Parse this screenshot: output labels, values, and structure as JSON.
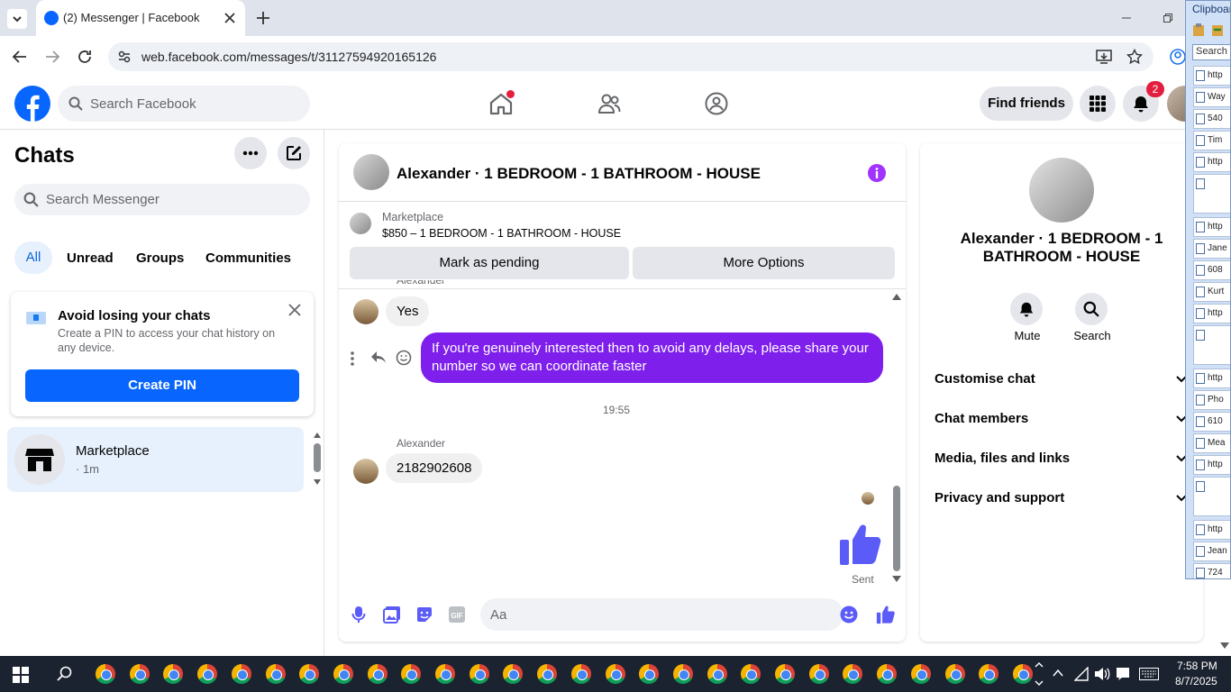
{
  "browser": {
    "tab_title": "(2) Messenger | Facebook",
    "url": "web.facebook.com/messages/t/31127594920165126"
  },
  "header": {
    "search_placeholder": "Search Facebook",
    "find_friends": "Find friends",
    "notifications_count": "2"
  },
  "sidebar": {
    "title": "Chats",
    "search_placeholder": "Search Messenger",
    "filters": [
      "All",
      "Unread",
      "Groups",
      "Communities"
    ],
    "pin_card": {
      "title": "Avoid losing your chats",
      "description": "Create a PIN to access your chat history on any device.",
      "button": "Create PIN"
    },
    "chat_item": {
      "name": "Marketplace",
      "time": "· 1m"
    }
  },
  "conversation": {
    "title": "Alexander · 1 BEDROOM - 1 BATHROOM - HOUSE",
    "marketplace_label": "Marketplace",
    "listing": "$850 – 1 BEDROOM - 1 BATHROOM - HOUSE",
    "mark_pending": "Mark as pending",
    "more_options": "More Options",
    "messages": {
      "sender_cut": "Alexander",
      "reply_yes": "Yes",
      "outgoing": "If you're genuinely interested then to avoid any delays, please share your number so we can coordinate faster",
      "timestamp": "19:55",
      "sender": "Alexander",
      "phone": "2182902608",
      "sent_status": "Sent"
    },
    "composer_placeholder": "Aa"
  },
  "details": {
    "name": "Alexander · 1 BEDROOM - 1 BATHROOM - HOUSE",
    "mute": "Mute",
    "search": "Search",
    "sections": [
      "Customise chat",
      "Chat members",
      "Media, files and links",
      "Privacy and support"
    ]
  },
  "clipboard": {
    "title": "Clipboard",
    "search": "Search (",
    "items": [
      "http",
      "Way",
      "540",
      "Tim",
      "http",
      "",
      "http",
      "Jane",
      "608",
      "Kurt",
      "http",
      "",
      "http",
      "Pho",
      "610",
      "Mea",
      "http",
      "",
      "http",
      "Jean",
      "724"
    ]
  },
  "taskbar": {
    "time": "7:58 PM",
    "date": "8/7/2025"
  },
  "colors": {
    "fb_blue": "#0866ff",
    "outgoing_bubble": "#7f1fec",
    "messenger_purple": "#a033ff"
  }
}
